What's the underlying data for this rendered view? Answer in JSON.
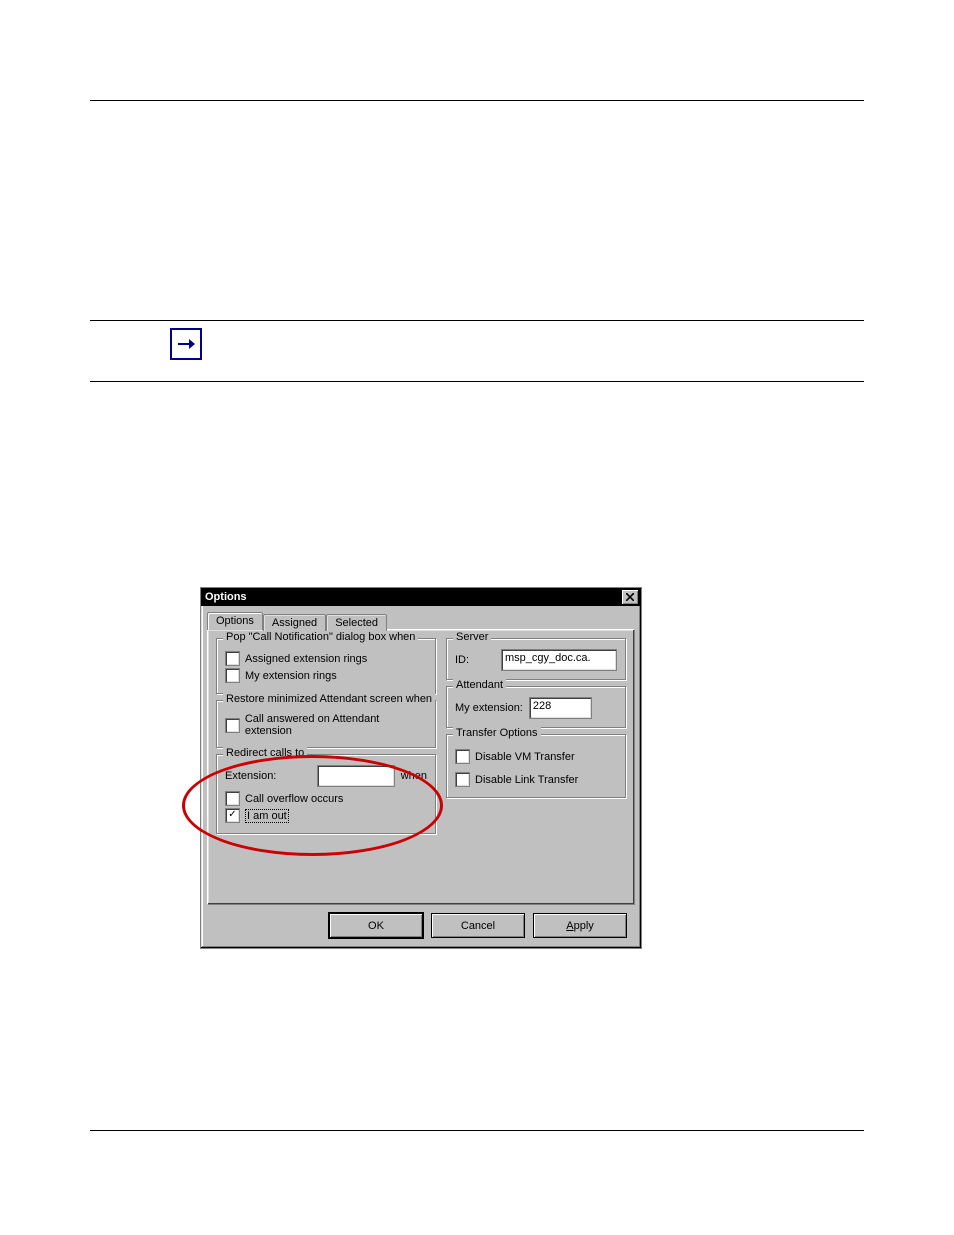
{
  "dialog": {
    "title": "Options",
    "tabs": {
      "t0": "Options",
      "t1": "Assigned",
      "t2": "Selected"
    },
    "groups": {
      "pop": {
        "legend": "Pop \"Call Notification\" dialog box when",
        "cb1": "Assigned extension rings",
        "cb2": "My extension rings"
      },
      "restore": {
        "legend": "Restore minimized Attendant screen when",
        "cb1": "Call answered on Attendant extension"
      },
      "redirect": {
        "legend": "Redirect calls to",
        "ext_label": "Extension:",
        "ext_value": "",
        "when": "when",
        "cb_overflow": "Call overflow occurs",
        "cb_iamout": "I am out"
      },
      "server": {
        "legend": "Server",
        "id_label": "ID:",
        "id_value": "msp_cgy_doc.ca."
      },
      "attendant": {
        "legend": "Attendant",
        "ext_label": "My extension:",
        "ext_value": "228"
      },
      "transfer": {
        "legend": "Transfer Options",
        "cb_vm": "Disable VM Transfer",
        "cb_link": "Disable Link Transfer"
      }
    },
    "buttons": {
      "ok": "OK",
      "cancel": "Cancel",
      "apply": "Apply"
    }
  }
}
